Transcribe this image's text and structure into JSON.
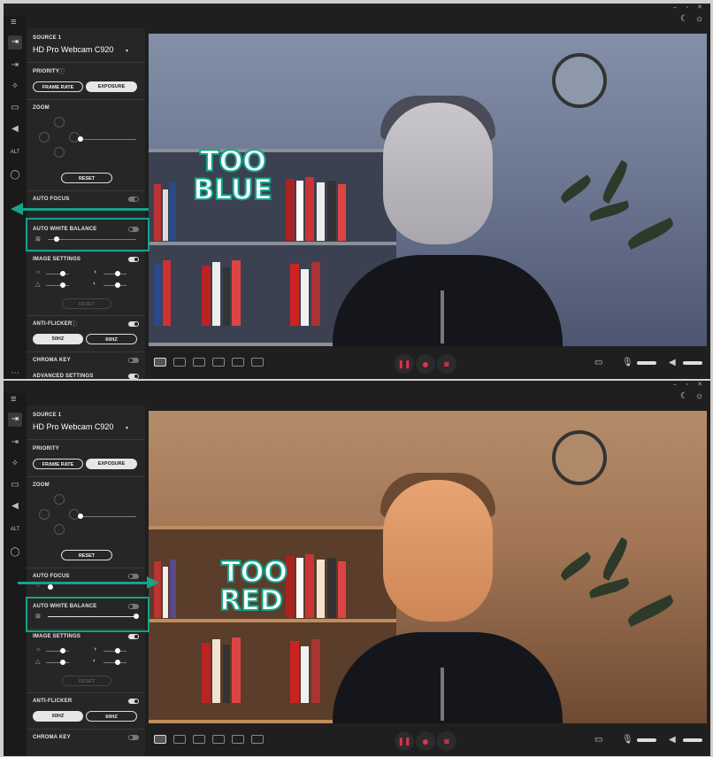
{
  "panels": [
    {
      "source_label": "SOURCE 1",
      "camera_name": "HD Pro Webcam C920",
      "priority_label": "PRIORITY",
      "priority_options": [
        "FRAME RATE",
        "EXPOSURE"
      ],
      "priority_selected": "EXPOSURE",
      "zoom_label": "ZOOM",
      "reset_label": "RESET",
      "auto_focus_label": "AUTO FOCUS",
      "auto_white_balance_label": "AUTO WHITE BALANCE",
      "white_balance_level": 0.1,
      "image_settings_label": "IMAGE SETTINGS",
      "reset_disabled_label": "RESET",
      "anti_flicker_label": "ANTI-FLICKER",
      "anti_flicker_options": [
        "50HZ",
        "60HZ"
      ],
      "anti_flicker_selected": "50HZ",
      "chroma_key_label": "CHROMA KEY",
      "advanced_label": "ADVANCED SETTINGS",
      "overlay_lines": [
        "TOO",
        "BLUE"
      ],
      "tint": "blue"
    },
    {
      "source_label": "SOURCE 1",
      "camera_name": "HD Pro Webcam C920",
      "priority_label": "PRIORITY",
      "priority_options": [
        "FRAME RATE",
        "EXPOSURE"
      ],
      "priority_selected": "EXPOSURE",
      "zoom_label": "ZOOM",
      "reset_label": "RESET",
      "auto_focus_label": "AUTO FOCUS",
      "auto_white_balance_label": "AUTO WHITE BALANCE",
      "white_balance_level": 1.0,
      "image_settings_label": "IMAGE SETTINGS",
      "reset_disabled_label": "RESET",
      "anti_flicker_label": "ANTI-FLICKER",
      "anti_flicker_options": [
        "50HZ",
        "60HZ"
      ],
      "anti_flicker_selected": "50HZ",
      "chroma_key_label": "CHROMA KEY",
      "advanced_label": "",
      "overlay_lines": [
        "TOO",
        "RED"
      ],
      "tint": "red"
    }
  ],
  "colors": {
    "accent": "#16a389",
    "panel_bg": "#1f1f1f",
    "record": "#e0334a"
  },
  "icons": [
    "menu-icon",
    "source1-icon",
    "source2-icon",
    "magic-wand-icon",
    "camera-icon",
    "speaker-icon",
    "alt-icon",
    "person-icon",
    "moon-icon",
    "sun-icon",
    "folder-icon",
    "mic-icon",
    "volume-icon",
    "pause-icon",
    "record-icon",
    "snapshot-icon"
  ]
}
